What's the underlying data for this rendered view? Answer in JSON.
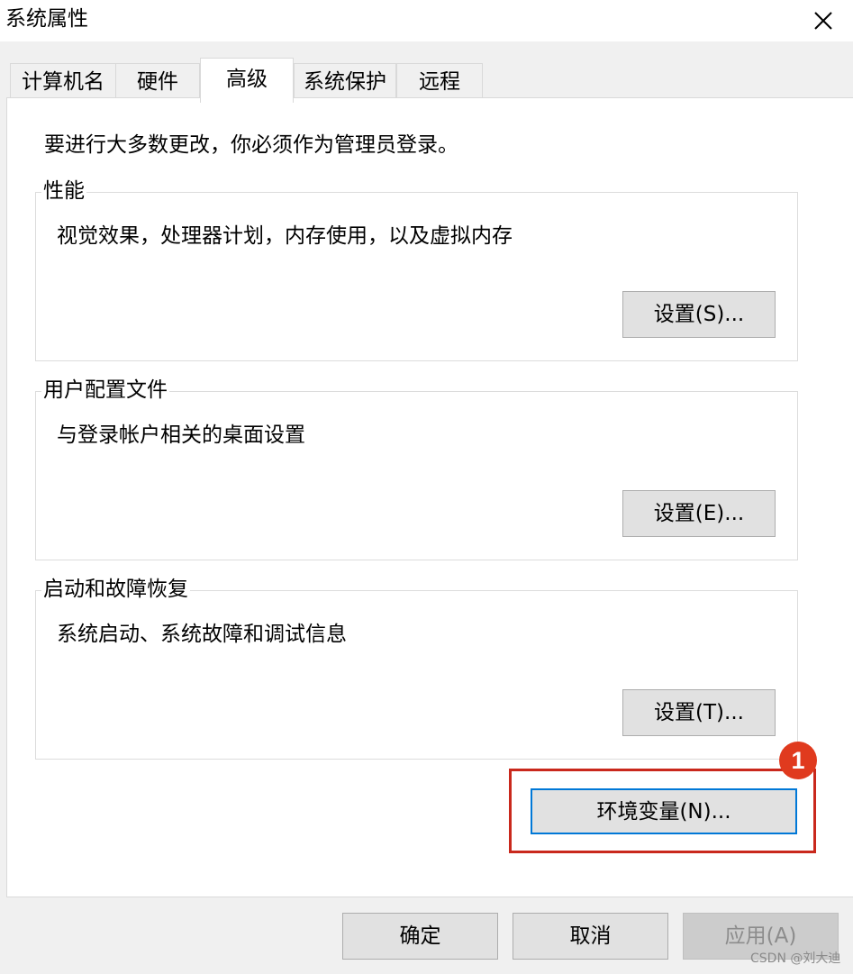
{
  "window": {
    "title": "系统属性",
    "close_icon": "×"
  },
  "tabs": [
    {
      "label": "计算机名",
      "active": false
    },
    {
      "label": "硬件",
      "active": false
    },
    {
      "label": "高级",
      "active": true
    },
    {
      "label": "系统保护",
      "active": false
    },
    {
      "label": "远程",
      "active": false
    }
  ],
  "advanced": {
    "notice": "要进行大多数更改，你必须作为管理员登录。",
    "groups": {
      "performance": {
        "title": "性能",
        "description": "视觉效果，处理器计划，内存使用，以及虚拟内存",
        "button": "设置(S)..."
      },
      "user_profiles": {
        "title": "用户配置文件",
        "description": "与登录帐户相关的桌面设置",
        "button": "设置(E)..."
      },
      "startup_recovery": {
        "title": "启动和故障恢复",
        "description": "系统启动、系统故障和调试信息",
        "button": "设置(T)..."
      }
    },
    "env_button": "环境变量(N)..."
  },
  "annotation": {
    "marker": "1",
    "color": "#c9281c"
  },
  "footer": {
    "ok": "确定",
    "cancel": "取消",
    "apply": "应用(A)",
    "apply_disabled": true
  },
  "watermark": "CSDN @刘大迪"
}
